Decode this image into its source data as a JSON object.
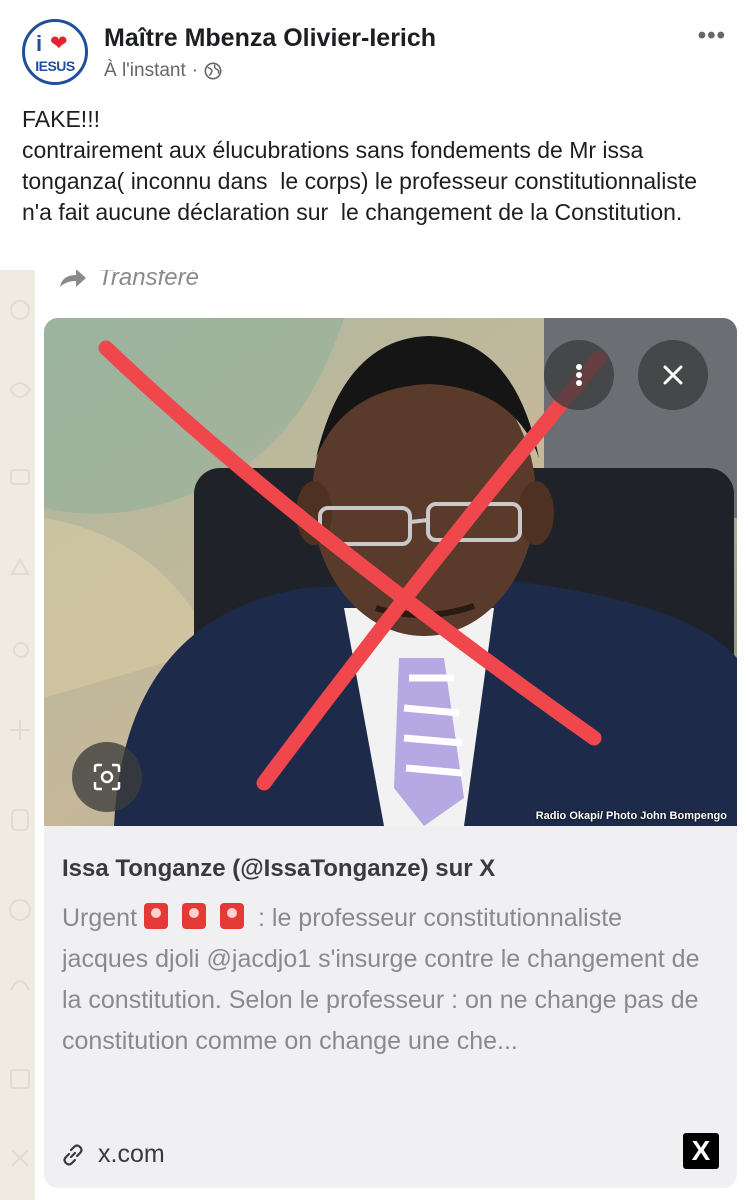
{
  "post": {
    "author": "Maître Mbenza Olivier-Ierich",
    "timestamp": "À l'instant",
    "separator": "·",
    "more_label": "•••",
    "text": "FAKE!!!\ncontrairement aux élucubrations sans fondements de Mr issa tonganza( inconnu dans  le corps) le professeur constitutionnaliste n'a fait aucune déclaration sur  le changement de la Constitution.",
    "avatar": {
      "letter": "i",
      "word": "IESUS"
    }
  },
  "screenshot": {
    "forward_label": "Transféré",
    "photo_credit": "Radio Okapi/ Photo John Bompengo",
    "link_preview": {
      "title": "Issa Tonganze (@IssaTonganze) sur X",
      "desc_prefix": "Urgent",
      "desc_rest": " : le professeur constitutionnaliste jacques djoli @jacdjo1 s'insurge contre le changement de la constitution. Selon le professeur : on ne change pas de constitution comme on change une che...",
      "domain": "x.com",
      "logo": "X"
    }
  },
  "colors": {
    "cross": "#f0474d",
    "accent": "#1f4f9a"
  },
  "icons": [
    "globe-icon",
    "more-icon",
    "forward-icon",
    "menu-icon",
    "close-icon",
    "lens-icon",
    "link-icon",
    "x-logo-icon",
    "siren-icon"
  ]
}
